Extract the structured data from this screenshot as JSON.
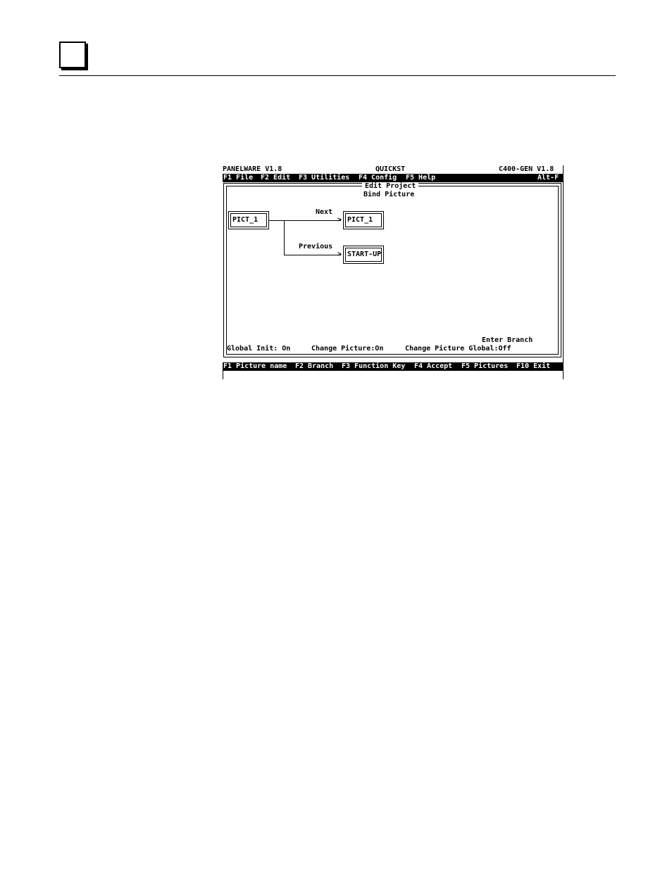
{
  "screen": {
    "title_left": "PANELWARE V1.8",
    "title_center": "QUICKST",
    "title_right": "C400-GEN V1.8",
    "menu": [
      {
        "label": "F1 File"
      },
      {
        "label": "F2 Edit"
      },
      {
        "label": "F3 Utilities"
      },
      {
        "label": "F4 Config"
      },
      {
        "label": "F5 Help"
      }
    ],
    "menu_right": "Alt-F",
    "frame_title": "Edit Project",
    "subtitle": "Bind Picture",
    "diagram": {
      "source": "PICT_1",
      "next_label": "Next",
      "next_target": "PICT_1",
      "previous_label": "Previous",
      "previous_target": "START-UP"
    },
    "prompt": "Enter Branch",
    "status": {
      "global_init": "Global Init: On",
      "change_picture": "Change Picture:On",
      "change_picture_global": "Change Picture Global:Off"
    },
    "function_keys": [
      {
        "label": "F1 Picture name"
      },
      {
        "label": "F2 Branch"
      },
      {
        "label": "F3 Function Key"
      },
      {
        "label": "F4 Accept"
      },
      {
        "label": "F5 Pictures"
      },
      {
        "label": "F10 Exit"
      }
    ]
  }
}
